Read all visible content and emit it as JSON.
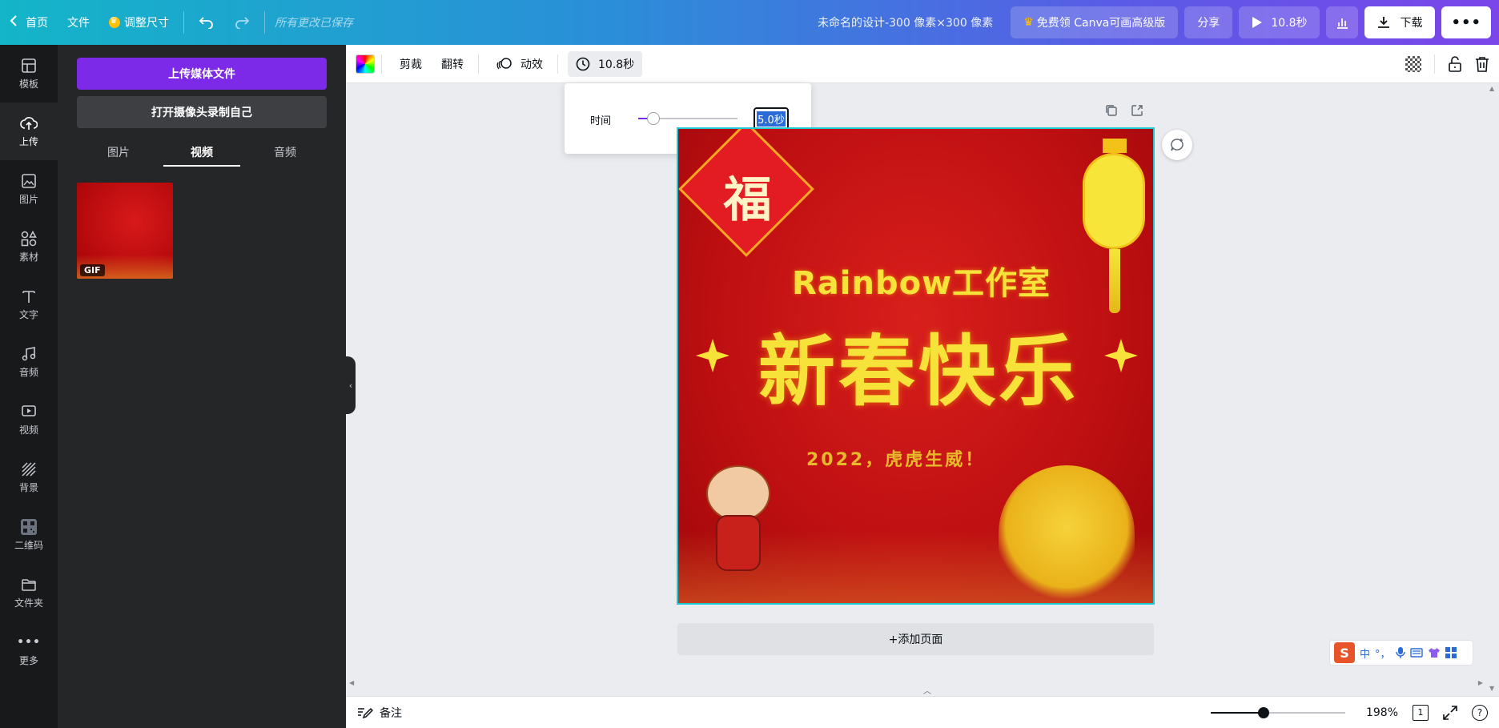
{
  "topbar": {
    "home": "首页",
    "file": "文件",
    "resize": "调整尺寸",
    "saved_status": "所有更改已保存",
    "doc_title": "未命名的设计-300 像素×300 像素",
    "upgrade": "免费领 Canva可画高级版",
    "share": "分享",
    "play_duration": "10.8秒",
    "download": "下载"
  },
  "rail": {
    "items": [
      {
        "label": "模板",
        "icon": "template-icon"
      },
      {
        "label": "上传",
        "icon": "upload-icon"
      },
      {
        "label": "图片",
        "icon": "photo-icon"
      },
      {
        "label": "素材",
        "icon": "elements-icon"
      },
      {
        "label": "文字",
        "icon": "text-icon"
      },
      {
        "label": "音频",
        "icon": "audio-icon"
      },
      {
        "label": "视频",
        "icon": "video-icon"
      },
      {
        "label": "背景",
        "icon": "background-icon"
      },
      {
        "label": "二维码",
        "icon": "qrcode-icon"
      },
      {
        "label": "文件夹",
        "icon": "folder-icon"
      },
      {
        "label": "更多",
        "icon": "more-icon"
      }
    ]
  },
  "panel": {
    "upload_button": "上传媒体文件",
    "camera_button": "打开摄像头录制自己",
    "tabs": [
      {
        "label": "图片"
      },
      {
        "label": "视频"
      },
      {
        "label": "音频"
      }
    ],
    "thumb_badge": "GIF"
  },
  "toolbar": {
    "crop": "剪裁",
    "flip": "翻转",
    "animate": "动效",
    "duration": "10.8秒"
  },
  "timing_popover": {
    "label": "时间",
    "slider_fraction": 0.15,
    "value": "5.0秒"
  },
  "design": {
    "fu": "福",
    "studio": "Rainbow工作室",
    "greeting": "新春快乐",
    "subline": "2022，虎虎生威！"
  },
  "canvas": {
    "add_page": "+添加页面"
  },
  "ime": {
    "logo": "S",
    "mode": "中",
    "punct": "°，"
  },
  "bottombar": {
    "notes": "备注",
    "zoom_fraction": 0.39,
    "zoom": "198%",
    "page": "1",
    "help": "?"
  },
  "colors": {
    "accent": "#7d2ae8",
    "selection": "#1ec8d4"
  }
}
